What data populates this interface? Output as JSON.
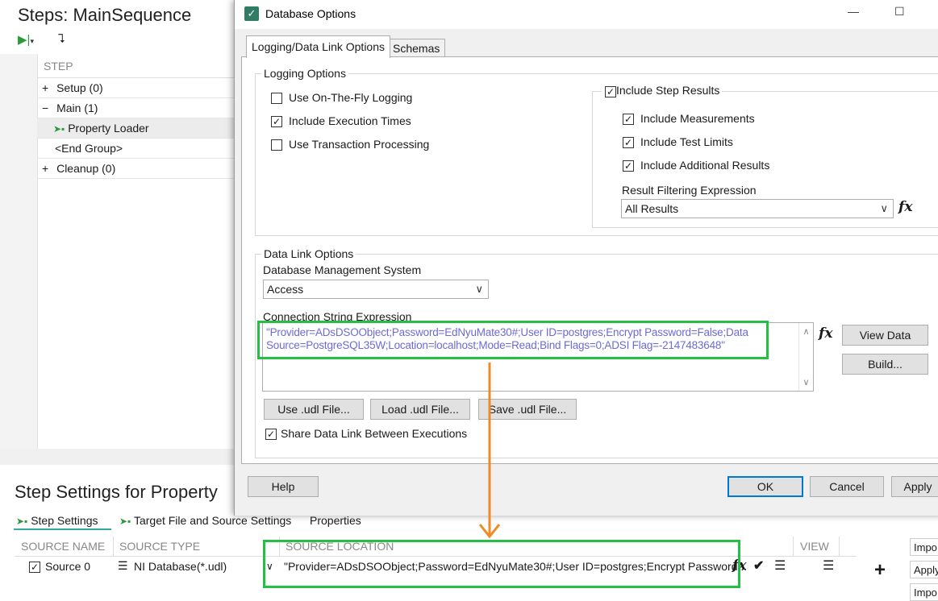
{
  "background_app": {
    "steps_title": "Steps: MainSequence",
    "grid_header": "STEP",
    "tree_rows": [
      {
        "toggle": "+",
        "label": "Setup (0)"
      },
      {
        "toggle": "−",
        "label": "Main (1)"
      },
      {
        "toggle": "",
        "label": "Property Loader",
        "icon": "arrow-step-icon"
      },
      {
        "toggle": "",
        "label": "<End Group>"
      },
      {
        "toggle": "+",
        "label": "Cleanup (0)"
      }
    ],
    "settings_title": "Step Settings for Property",
    "settings_tabs": [
      "Step Settings",
      "Target File and Source Settings",
      "Properties"
    ],
    "source_headers": [
      "SOURCE NAME",
      "SOURCE TYPE",
      "SOURCE LOCATION",
      "VIEW"
    ],
    "source_row": {
      "name": "Source 0",
      "type": "NI Database(*.udl)",
      "location": "\"Provider=ADsDSOObject;Password=EdNyuMate30#;User ID=postgres;Encrypt Password..."
    },
    "right_buttons": [
      "Impo",
      "Apply",
      "Impo"
    ],
    "plus": "+"
  },
  "dialog": {
    "title": "Database Options",
    "window_controls": {
      "minimize": "—",
      "maximize": "☐"
    },
    "tabs": [
      "Logging/Data Link Options",
      "Schemas"
    ],
    "logging_options": {
      "label": "Logging Options",
      "items": [
        {
          "label": "Use On-The-Fly Logging",
          "checked": false
        },
        {
          "label": "Include Execution Times",
          "checked": true
        },
        {
          "label": "Use Transaction Processing",
          "checked": false
        }
      ],
      "include_step_results": {
        "label": "Include Step Results",
        "checked": true
      },
      "step_result_items": [
        {
          "label": "Include Measurements",
          "checked": true
        },
        {
          "label": "Include Test Limits",
          "checked": true
        },
        {
          "label": "Include Additional Results",
          "checked": true
        }
      ],
      "filter_label": "Result Filtering Expression",
      "filter_value": "All Results"
    },
    "data_link": {
      "label": "Data Link Options",
      "dbms_label": "Database Management System",
      "dbms_value": "Access",
      "conn_label": "Connection String Expression",
      "conn_line1": "\"Provider=ADsDSOObject;Password=EdNyuMate30#;User ID=postgres;Encrypt Password=False;Data",
      "conn_line2": "Source=PostgreSQL35W;Location=localhost;Mode=Read;Bind Flags=0;ADSI Flag=-2147483648\"",
      "view_data": "View Data",
      "build": "Build...",
      "use_udl": "Use .udl File...",
      "load_udl": "Load .udl File...",
      "save_udl": "Save .udl File...",
      "share_label": "Share Data Link Between Executions",
      "share_checked": true
    },
    "footer": {
      "help": "Help",
      "ok": "OK",
      "cancel": "Cancel",
      "apply": "Apply"
    }
  },
  "colors": {
    "highlight_box": "#23c043",
    "arrow": "#f08a24",
    "conn_text": "#6b6bd6",
    "title_icon": "#2f7d64"
  }
}
